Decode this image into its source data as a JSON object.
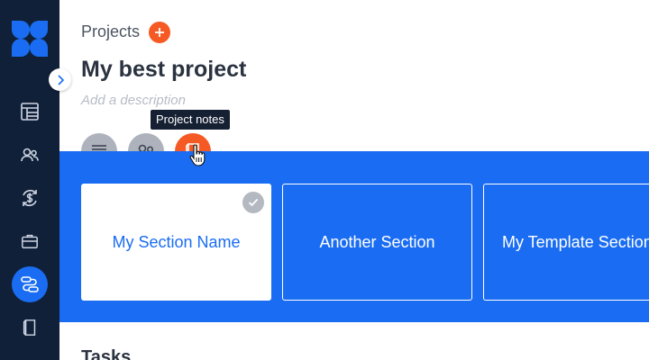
{
  "header": {
    "breadcrumb": "Projects",
    "project_title": "My best project",
    "description_placeholder": "Add a description"
  },
  "tooltip": "Project notes",
  "action_buttons": [
    {
      "icon": "list-icon"
    },
    {
      "icon": "team-icon"
    },
    {
      "icon": "notes-icon"
    }
  ],
  "sidebar": {
    "items": [
      {
        "icon": "table-icon"
      },
      {
        "icon": "people-icon"
      },
      {
        "icon": "dollar-cycle-icon"
      },
      {
        "icon": "briefcase-icon"
      },
      {
        "icon": "workflow-icon",
        "active": true
      },
      {
        "icon": "notebook-icon"
      }
    ]
  },
  "sections": [
    {
      "name": "My Section Name",
      "selected": true
    },
    {
      "name": "Another Section"
    },
    {
      "name": "My Template Section"
    }
  ],
  "tasks_heading": "Tasks",
  "colors": {
    "sidebar": "#102039",
    "accent_blue": "#1a6df2",
    "accent_orange": "#f55a24"
  }
}
